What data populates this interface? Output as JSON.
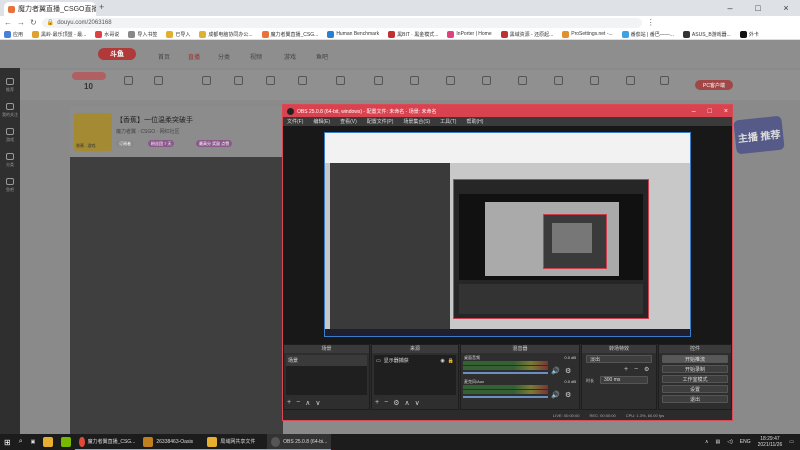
{
  "browser": {
    "tab_title": "魔力者翼直播_CSGO直播_斗鱼",
    "url": "douyu.com/2063168",
    "bookmarks": [
      "应用",
      "黑岭·最乐顶盟 - 最...",
      "水哥说",
      "导入书签",
      "已导入",
      "成都电脑协同办公...",
      "魔力者翼直播_CSG...",
      "Human Benchmark",
      "黑BIT · 黑金模式...",
      "InPorter | Home",
      "黑域资源 - 还原起...",
      "ProSettings.net -...",
      "番茄站 | 番巴——...",
      "ASUS_B游戏器...",
      "外卡"
    ]
  },
  "site": {
    "logo": "斗鱼",
    "nav": [
      "首页",
      "直播",
      "分类",
      "视频",
      "游戏",
      "鱼吧"
    ],
    "user_level": "10",
    "room_title": "【香蕉】一位温柔突破手",
    "room_sub": "魔力者翼 · CSGO · 网红社区",
    "streamer": "香蕉 - 游戏",
    "badges": [
      "订阅者",
      "粉丝团 7 天",
      "最高分 奖励 点赞"
    ],
    "follow_btn": "PC客户端",
    "sticker": "主播 推荐",
    "left_menu": [
      "推荐",
      "我的关注",
      "游戏",
      "分类",
      "鱼吧"
    ]
  },
  "obs": {
    "title": "OBS 25.0.8 (64-bit, windows) - 配置文件: 未命名 - 场景: 未命名",
    "menu": [
      "文件(F)",
      "编辑(E)",
      "查看(V)",
      "配置文件(P)",
      "场景集合(S)",
      "工具(T)",
      "帮助(H)"
    ],
    "docks": {
      "scenes": {
        "title": "场景",
        "items": [
          "场景"
        ]
      },
      "sources": {
        "title": "来源",
        "items": [
          "显示器捕获"
        ]
      },
      "mixer": {
        "title": "混音器",
        "channels": [
          {
            "name": "桌面音频",
            "db": "0.0 dB"
          },
          {
            "name": "麦克风/Aux",
            "db": "0.0 dB"
          }
        ]
      },
      "transitions": {
        "title": "转场特效",
        "type": "淡出",
        "duration_label": "时长",
        "duration": "300 ms"
      },
      "controls": {
        "title": "控件",
        "buttons": [
          "开始推流",
          "开始录制",
          "工作室模式",
          "设置",
          "退出"
        ]
      }
    },
    "status": [
      "LIVE: 00:00:00",
      "REC: 00:00:00",
      "CPU: 1.3%, 60.00 fps"
    ]
  },
  "taskbar": {
    "apps": [
      "魔力者翼直播_CSG...",
      "26338463-Oasis",
      "局域网共享文件",
      "OBS 25.0.8 (64-bi..."
    ],
    "lang": "ENG",
    "time": "18:29:47",
    "date": "2021/11/26"
  },
  "colors": {
    "obs_accent": "#d8434f",
    "taskbar": "#1c1c1c",
    "brand": "#b03a3a"
  }
}
